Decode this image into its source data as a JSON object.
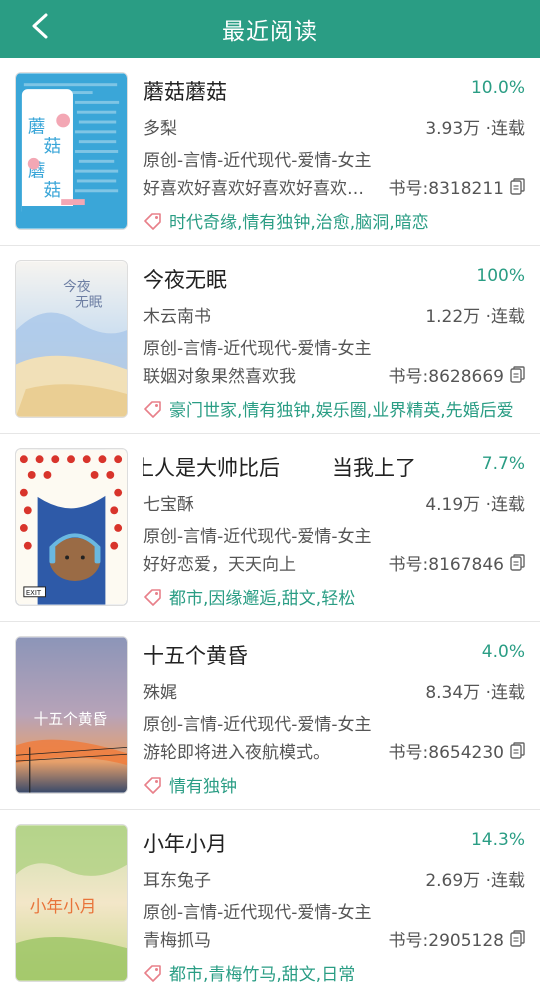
{
  "header": {
    "title": "最近阅读"
  },
  "colors": {
    "accent": "#2a9d84",
    "tag_icon": "#e8808a"
  },
  "books": [
    {
      "title": "蘑菇蘑菇",
      "progress": "10.0%",
      "author": "多梨",
      "stats": "3.93万 ·连载",
      "category": "原创-言情-近代现代-爱情-女主",
      "intro": "好喜欢好喜欢好喜欢好喜欢好喜欢",
      "book_id": "书号:8318211",
      "tags": "时代奇缘,情有独钟,治愈,脑洞,暗恋",
      "cover_text": "蘑菇蘑菇"
    },
    {
      "title": "今夜无眠",
      "progress": "100%",
      "author": "木云南书",
      "stats": "1.22万 ·连载",
      "category": "原创-言情-近代现代-爱情-女主",
      "intro": "联姻对象果然喜欢我",
      "book_id": "书号:8628669",
      "tags": "豪门世家,情有独钟,娱乐圈,业界精英,先婚后爱",
      "cover_text": "今夜无眠"
    },
    {
      "title": "当我上了大帅比后",
      "title_parts": {
        "left": "上人是大帅比后",
        "right": "当我上了"
      },
      "progress": "7.7%",
      "author": "七宝酥",
      "stats": "4.19万 ·连载",
      "category": "原创-言情-近代现代-爱情-女主",
      "intro": "好好恋爱，天天向上",
      "book_id": "书号:8167846",
      "tags": "都市,因缘邂逅,甜文,轻松",
      "cover_text": "EXIT"
    },
    {
      "title": "十五个黄昏",
      "progress": "4.0%",
      "author": "殊娓",
      "stats": "8.34万 ·连载",
      "category": "原创-言情-近代现代-爱情-女主",
      "intro": "游轮即将进入夜航模式。",
      "book_id": "书号:8654230",
      "tags": "情有独钟",
      "cover_text": "十五个黄昏"
    },
    {
      "title": "小年小月",
      "progress": "14.3%",
      "author": "耳东兔子",
      "stats": "2.69万 ·连载",
      "category": "原创-言情-近代现代-爱情-女主",
      "intro": "青梅抓马",
      "book_id": "书号:2905128",
      "tags": "都市,青梅竹马,甜文,日常",
      "cover_text": "小年小月"
    }
  ]
}
